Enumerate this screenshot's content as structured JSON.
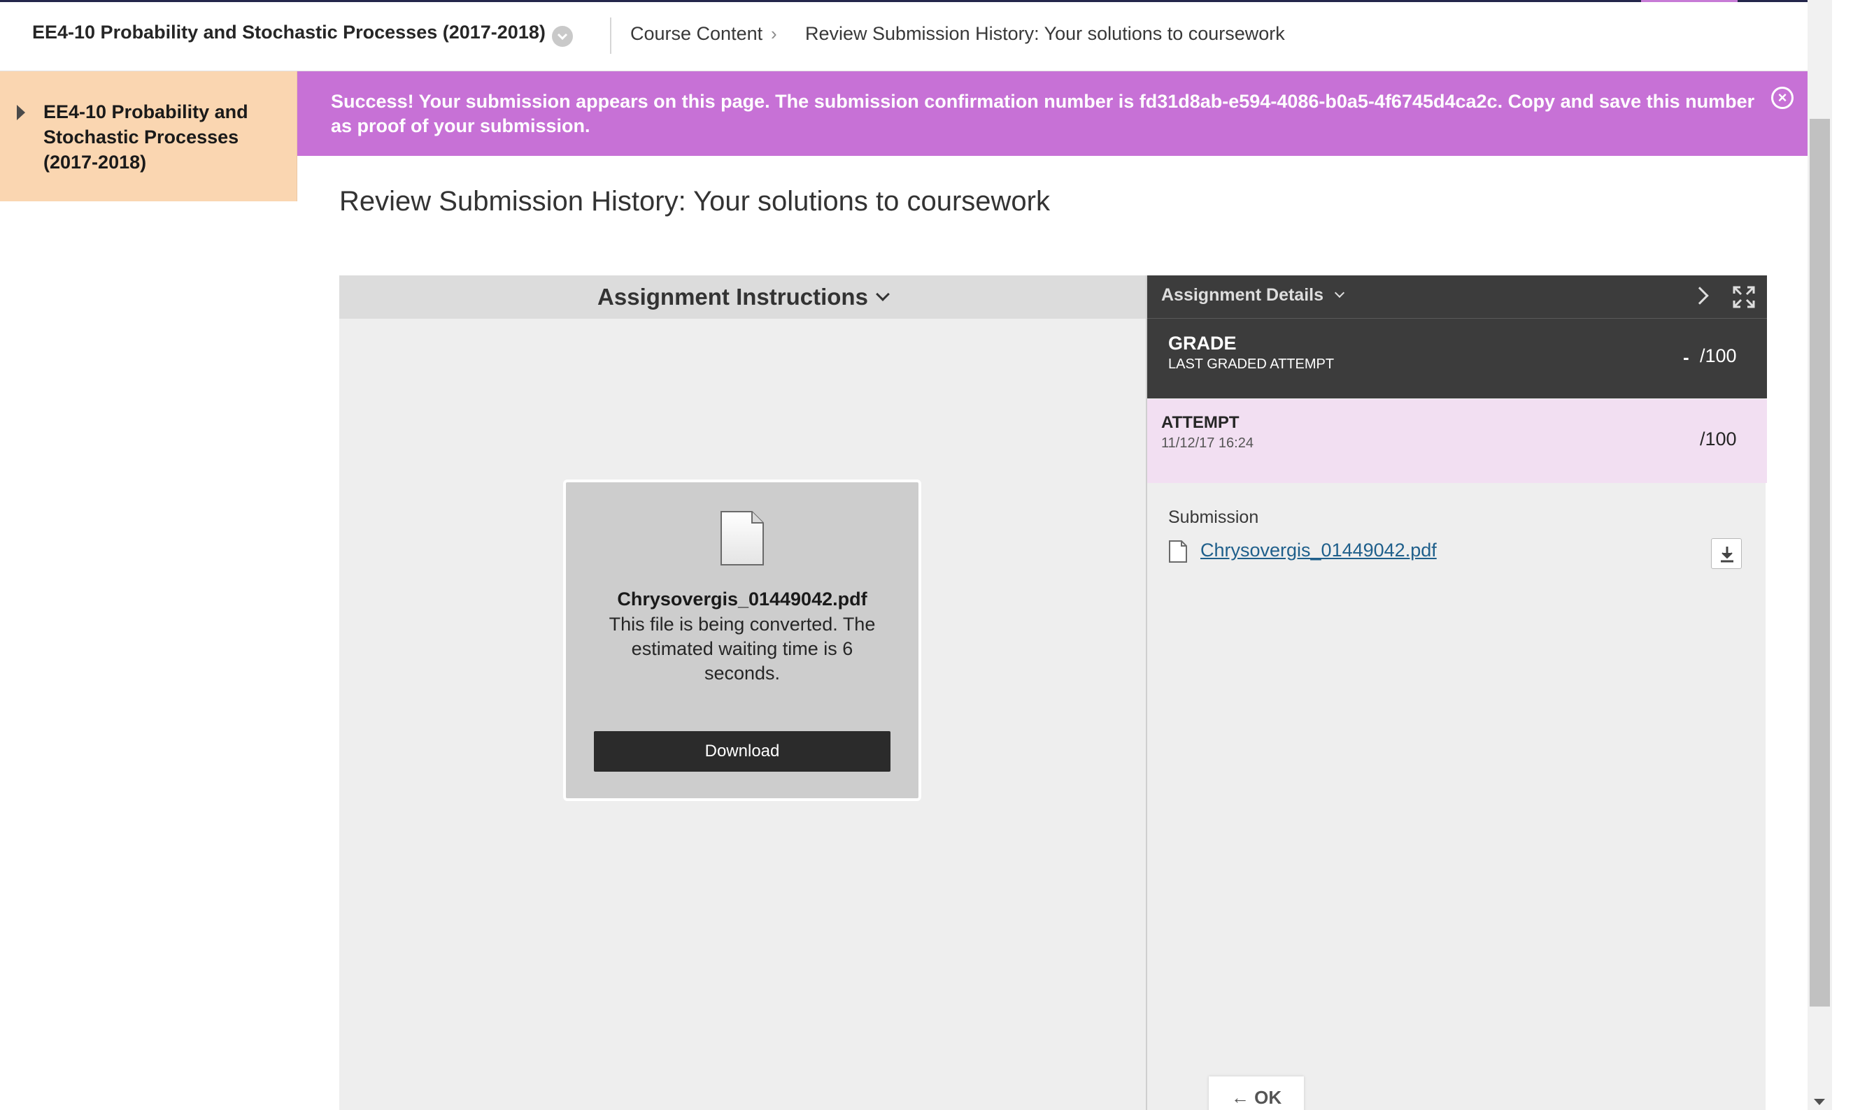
{
  "topbar": {
    "course_title": "EE4-10 Probability and Stochastic Processes (2017-2018)",
    "breadcrumb": [
      "Course Content",
      "Review Submission History: Your solutions to coursework"
    ],
    "breadcrumb_separator": "›"
  },
  "leftnav": {
    "course_label": "EE4-10 Probability and Stochastic Processes (2017-2018)"
  },
  "banner": {
    "message": "Success! Your submission appears on this page. The submission confirmation number is fd31d8ab-e594-4086-b0a5-4f6745d4ca2c. Copy and save this number as proof of your submission.",
    "close_glyph": "×",
    "color": "#c771d6"
  },
  "page": {
    "heading": "Review Submission History: Your solutions to coursework"
  },
  "instructions": {
    "header": "Assignment Instructions",
    "card": {
      "file_name": "Chrysovergis_01449042.pdf",
      "note": "This file is being converted. The estimated waiting time is 6 seconds.",
      "download_label": "Download"
    }
  },
  "details": {
    "header": "Assignment Details",
    "grade": {
      "title": "GRADE",
      "subtitle": "LAST GRADED ATTEMPT",
      "value": "-",
      "out_of": "/100"
    },
    "attempt": {
      "title": "ATTEMPT",
      "timestamp": "11/12/17 16:24",
      "out_of": "/100"
    },
    "submission": {
      "label": "Submission",
      "file_link": "Chrysovergis_01449042.pdf"
    },
    "ok_label": "← OK"
  },
  "icons": {
    "course_menu": "chevron-down-circle-icon",
    "nav_expand": "triangle-right-icon",
    "banner_close": "close-circle-icon",
    "file": "document-icon",
    "download": "download-icon",
    "collapse_panel": "chevron-right-icon",
    "fullscreen": "expand-icon"
  }
}
